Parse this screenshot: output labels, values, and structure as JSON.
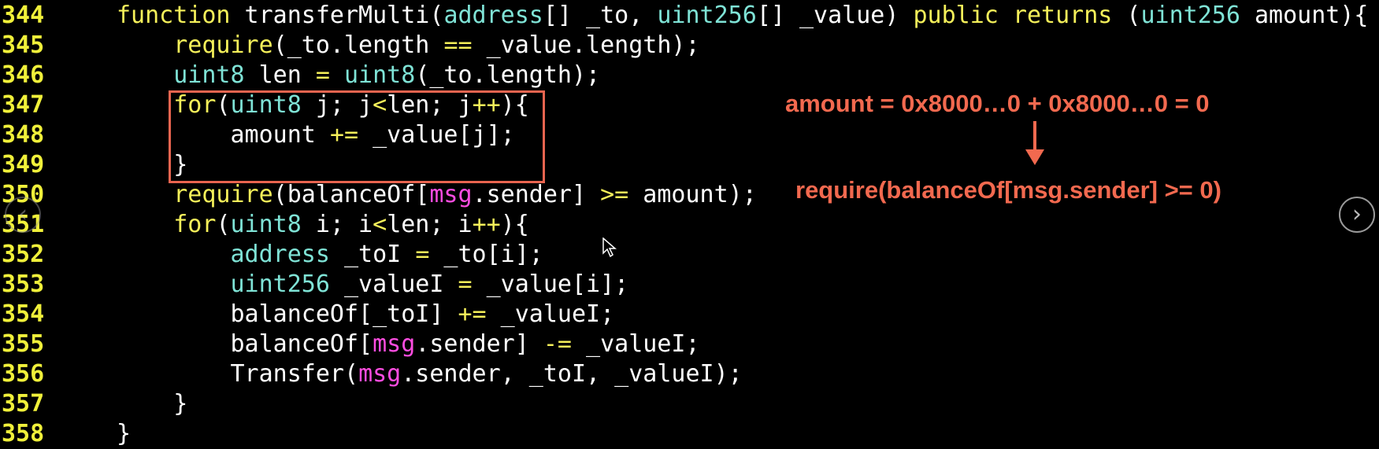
{
  "code": {
    "lines": [
      {
        "num": "344",
        "indent": "",
        "t": [
          {
            "c": "kw",
            "s": "function"
          },
          {
            "c": "",
            "s": " transferMulti("
          },
          {
            "c": "ty",
            "s": "address"
          },
          {
            "c": "",
            "s": "[] _to, "
          },
          {
            "c": "ty",
            "s": "uint256"
          },
          {
            "c": "",
            "s": "[] _value) "
          },
          {
            "c": "kw",
            "s": "public"
          },
          {
            "c": "",
            "s": " "
          },
          {
            "c": "kw",
            "s": "returns"
          },
          {
            "c": "",
            "s": " ("
          },
          {
            "c": "ty",
            "s": "uint256"
          },
          {
            "c": "",
            "s": " amount){"
          }
        ]
      },
      {
        "num": "345",
        "indent": "    ",
        "t": [
          {
            "c": "kw",
            "s": "require"
          },
          {
            "c": "",
            "s": "(_to.length "
          },
          {
            "c": "op",
            "s": "=="
          },
          {
            "c": "",
            "s": " _value.length);"
          }
        ]
      },
      {
        "num": "346",
        "indent": "    ",
        "t": [
          {
            "c": "ty",
            "s": "uint8"
          },
          {
            "c": "",
            "s": " len "
          },
          {
            "c": "op",
            "s": "="
          },
          {
            "c": "",
            "s": " "
          },
          {
            "c": "ty",
            "s": "uint8"
          },
          {
            "c": "",
            "s": "(_to.length);"
          }
        ]
      },
      {
        "num": "347",
        "indent": "    ",
        "t": [
          {
            "c": "kw",
            "s": "for"
          },
          {
            "c": "",
            "s": "("
          },
          {
            "c": "ty",
            "s": "uint8"
          },
          {
            "c": "",
            "s": " j; j"
          },
          {
            "c": "op",
            "s": "<"
          },
          {
            "c": "",
            "s": "len; j"
          },
          {
            "c": "op",
            "s": "++"
          },
          {
            "c": "",
            "s": "){"
          }
        ]
      },
      {
        "num": "348",
        "indent": "        ",
        "t": [
          {
            "c": "",
            "s": "amount "
          },
          {
            "c": "op",
            "s": "+="
          },
          {
            "c": "",
            "s": " _value[j];"
          }
        ]
      },
      {
        "num": "349",
        "indent": "    ",
        "t": [
          {
            "c": "",
            "s": "}"
          }
        ]
      },
      {
        "num": "350",
        "indent": "    ",
        "t": [
          {
            "c": "kw",
            "s": "require"
          },
          {
            "c": "",
            "s": "(balanceOf["
          },
          {
            "c": "mg",
            "s": "msg"
          },
          {
            "c": "",
            "s": ".sender] "
          },
          {
            "c": "op",
            "s": ">="
          },
          {
            "c": "",
            "s": " amount);"
          }
        ]
      },
      {
        "num": "351",
        "indent": "    ",
        "t": [
          {
            "c": "kw",
            "s": "for"
          },
          {
            "c": "",
            "s": "("
          },
          {
            "c": "ty",
            "s": "uint8"
          },
          {
            "c": "",
            "s": " i; i"
          },
          {
            "c": "op",
            "s": "<"
          },
          {
            "c": "",
            "s": "len; i"
          },
          {
            "c": "op",
            "s": "++"
          },
          {
            "c": "",
            "s": "){"
          }
        ]
      },
      {
        "num": "352",
        "indent": "        ",
        "t": [
          {
            "c": "ty",
            "s": "address"
          },
          {
            "c": "",
            "s": " _toI "
          },
          {
            "c": "op",
            "s": "="
          },
          {
            "c": "",
            "s": " _to[i];"
          }
        ]
      },
      {
        "num": "353",
        "indent": "        ",
        "t": [
          {
            "c": "ty",
            "s": "uint256"
          },
          {
            "c": "",
            "s": " _valueI "
          },
          {
            "c": "op",
            "s": "="
          },
          {
            "c": "",
            "s": " _value[i];"
          }
        ]
      },
      {
        "num": "354",
        "indent": "        ",
        "t": [
          {
            "c": "",
            "s": "balanceOf[_toI] "
          },
          {
            "c": "op",
            "s": "+="
          },
          {
            "c": "",
            "s": " _valueI;"
          }
        ]
      },
      {
        "num": "355",
        "indent": "        ",
        "t": [
          {
            "c": "",
            "s": "balanceOf["
          },
          {
            "c": "mg",
            "s": "msg"
          },
          {
            "c": "",
            "s": ".sender] "
          },
          {
            "c": "op",
            "s": "-="
          },
          {
            "c": "",
            "s": " _valueI;"
          }
        ]
      },
      {
        "num": "356",
        "indent": "        ",
        "t": [
          {
            "c": "",
            "s": "Transfer("
          },
          {
            "c": "mg",
            "s": "msg"
          },
          {
            "c": "",
            "s": ".sender, _toI, _valueI);"
          }
        ]
      },
      {
        "num": "357",
        "indent": "    ",
        "t": [
          {
            "c": "",
            "s": "}"
          }
        ]
      },
      {
        "num": "358",
        "indent": "",
        "t": [
          {
            "c": "",
            "s": "}"
          }
        ]
      }
    ]
  },
  "annotations": {
    "top": "amount = 0x8000…0 + 0x8000…0 = 0",
    "bottom": "require(balanceOf[msg.sender] >= 0)"
  },
  "nav": {
    "prev_icon": "chevron-left-icon",
    "prev_glyph": "‹",
    "next_icon": "chevron-right-icon",
    "next_glyph": "›"
  },
  "colors": {
    "background": "#000000",
    "line_number": "#f0f03a",
    "keyword": "#f5f05a",
    "type": "#7fe3d6",
    "msg": "#ff4de1",
    "annotation": "#f2694f"
  }
}
